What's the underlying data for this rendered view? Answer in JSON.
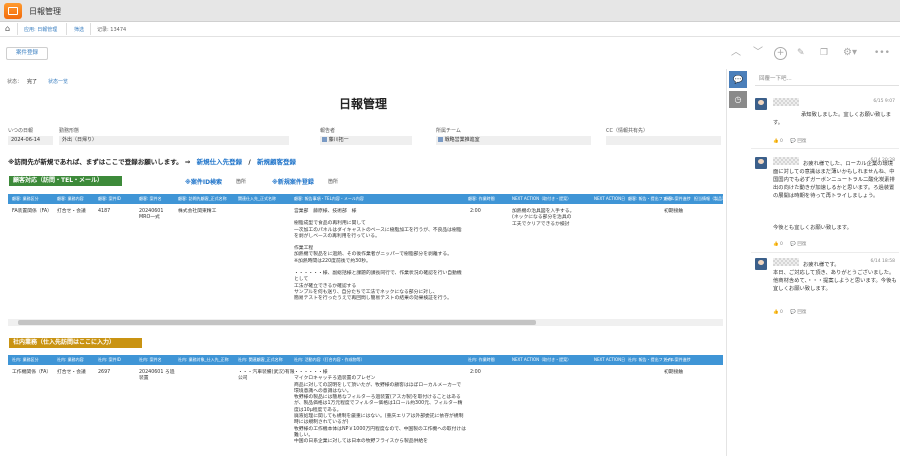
{
  "app": {
    "title": "日報管理"
  },
  "breadcrumb": {
    "home_icon": "home-icon",
    "app_label": "应用: 日報管理",
    "filter_label": "筛选",
    "record_label": "记录: 13474"
  },
  "toolbar": {
    "register_label": "案件登録"
  },
  "status": {
    "label": "状态：",
    "value": "完了",
    "link": "状态一览"
  },
  "page": {
    "title": "日報管理"
  },
  "fields": {
    "date_label": "いつの日報",
    "date_value": "2024-06-14",
    "type_label": "勤務形態",
    "type_value": "外出（日帰り）",
    "reporter_label": "報告者",
    "reporter_value": "藤川拓一",
    "team_label": "所属チーム",
    "team_value": "戦略営業推進室",
    "cc_label": "CC（情報共有先）"
  },
  "notice": {
    "text": "※訪問先が新規であれば、まずはここで登録お願いします。 ⇒",
    "link1": "新規仕入先登録",
    "slash": "/",
    "link2": "新規顧客登録"
  },
  "section1": {
    "title": "顧客対応（訪問・TEL・メール）",
    "id_search": "※案件ID検索",
    "id_unit": "箇所",
    "new_case": "※新規案件登録",
    "new_unit": "箇所",
    "headers": [
      "顧客: 業務区分",
      "顧客: 業務内容",
      "顧客: 案件ID",
      "顧客: 案件名",
      "顧客: 訪問先顧客_正式名称",
      "関連仕入先_正式名称",
      "顧客: 報告事項・TEL内容・メール内容",
      "顧客: 作業時間",
      "NEXT ACTION（取付き・提案）",
      "NEXT ACTION日",
      "顧客: 報告・提出ファイル",
      "顧客: 案件進捗",
      "担当情報（製品事業所）"
    ],
    "row": {
      "category": "FA装置関係（FA）",
      "content": "打合せ・会議",
      "case_id": "4187",
      "case_name": "20240601 MRO一式",
      "customer": "株式会社関東精工",
      "report": [
        "営業部　藤原様、技術部　様",
        "",
        "樹脂成型で食品の再利用に関して",
        "一次加工のパネルはダイキャストのベースに樹脂加工を行うが、不良品は樹脂を剥がしベースの再利用を行っている。",
        "",
        "作業工程",
        "加熱機で製品をに過熱、その後作業者がニッパーで樹脂部分を剥離する。",
        "※加熱時間は220度前後で約30秒。",
        "",
        "・・・・・・様、副総括様と課題的課長同行で、作業状況の確認を行い自動機として",
        "工法が確立できるか確認する",
        "サンプルを何も送り、自分たちで工法でネックになる部分に対し、",
        "簡易テストを行ったうえで再回問し簡易テストの結果の効果検証を行う。"
      ],
      "work_time": "2:00",
      "next_action": [
        "加熱機の治具図を入手する。",
        "(ネックになる部分を治具の",
        "工夫でクリアできるか検討"
      ],
      "progress": "初期接触"
    }
  },
  "section2": {
    "title": "社内業務（仕入先訪問はここに入力）",
    "headers": [
      "社内: 業務区分",
      "社内: 業務内容",
      "社内: 案件ID",
      "社内: 案件名",
      "社内: 業務対象_仕入先_正称",
      "社内: 関連顧客_正式名称",
      "社内: 活動内容（打合内容・作成物等）",
      "社内: 作業時間",
      "NEXT ACTION（取付き・提案）",
      "NEXT ACTION日",
      "社内: 報告・提出ファイル",
      "社内: 案件進捗"
    ],
    "row": {
      "category": "工作機関係（FA）",
      "content": "打合せ・会議",
      "case_id": "2697",
      "case_name": "20240601 ろ過装置",
      "supplier": "・・・汽車装備(武汉)有限公司",
      "report": [
        "・・・・・・様",
        "マイクロキャッチろ過装置のプレゼン",
        "商品に対しての説明をして頂いたが、牧野様の顧客はほぼローカルメーカーで環境意識への意識はない。",
        "牧野様の製品には簡易なフィルターろ過装置(アスカ製)を取付けることはあるが、製品価格は1万元程度でフィルター価格は1ロール約300元、フィルター精度は10μ程度である。",
        "廃液処理に関しても規制を厳重にはない。(重庆エリアは外部委託に依存が規制時には規制されているが)",
        "牧野様の工作機本体はNP￥1000万円程度なので、中国製の工作機への取付けは難しい。",
        "中国の日系企業に対しては日本の牧野フライスから製品供給を"
      ],
      "work_time": "2:00",
      "progress": "初期接触"
    }
  },
  "comments": {
    "placeholder": "回覆一下吧...",
    "items": [
      {
        "time": "6/15 9:07",
        "body": [
          "承知致しました。宜しくお願い致します。"
        ],
        "likes": "0",
        "reply": "回復"
      },
      {
        "time": "6/14 20:28",
        "body": [
          "お疲れ様でした、ローカル企業の環境面に対しての意識はまだ薄いかもしれませんね、中国国内でも必ずガーボンニュートラル二酸化炭素排出の向けた動きが加速しるかと思います。ろ過装置の展開は時期を待って再トライしましょう。",
          "今後とも宜しくお願い致します。"
        ],
        "likes": "0",
        "reply": "回復"
      },
      {
        "time": "6/14 18:58",
        "body": [
          "お疲れ様です。",
          "本日、ご対応して頂き、ありがとうございました。他商材含めて、・・・提案しようと思います。今後も宜しくお願い致します。"
        ],
        "likes": "0",
        "reply": "回復"
      }
    ]
  },
  "colors": {
    "section1": "#3d8a3a",
    "section2": "#c99312",
    "header_blue": "#3f95d6",
    "link": "#1e73c9"
  }
}
